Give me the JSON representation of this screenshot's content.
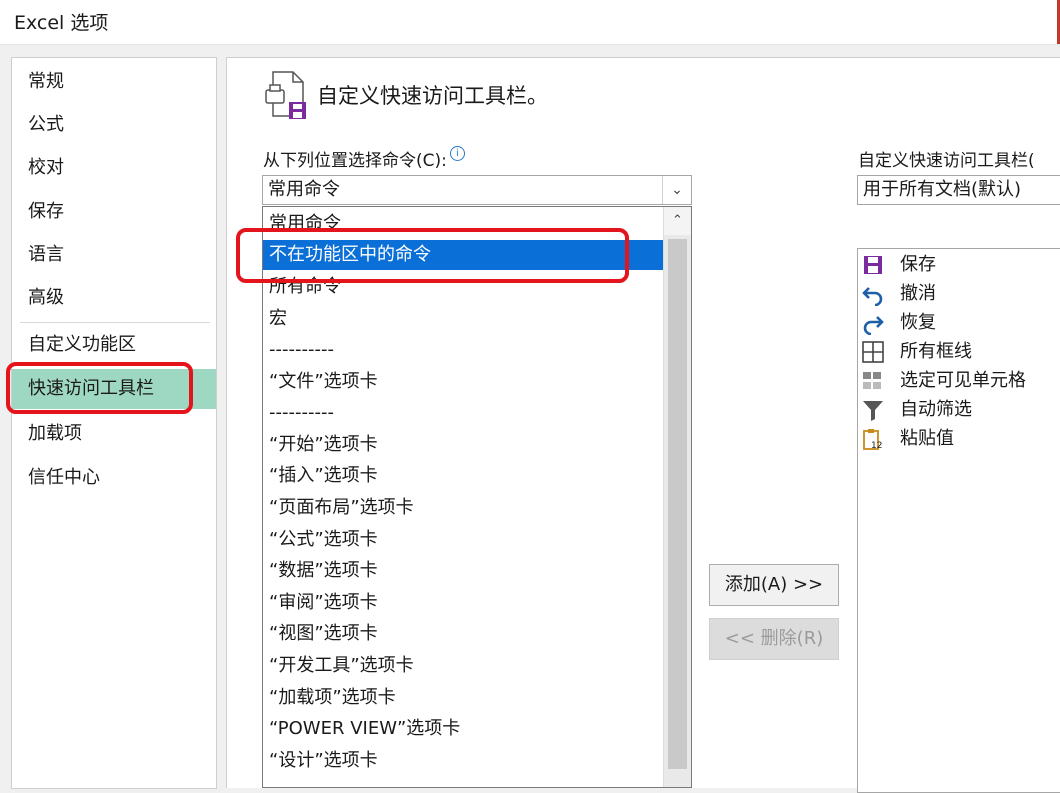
{
  "window": {
    "title": "Excel 选项"
  },
  "sidebar": {
    "items": [
      {
        "label": "常规"
      },
      {
        "label": "公式"
      },
      {
        "label": "校对"
      },
      {
        "label": "保存"
      },
      {
        "label": "语言"
      },
      {
        "label": "高级"
      },
      {
        "label": "自定义功能区"
      },
      {
        "label": "快速访问工具栏"
      },
      {
        "label": "加载项"
      },
      {
        "label": "信任中心"
      }
    ],
    "selected": "快速访问工具栏"
  },
  "main": {
    "heading": "自定义快速访问工具栏。",
    "choose_label": "从下列位置选择命令(C):",
    "choose_value": "常用命令",
    "commands": [
      "常用命令",
      "不在功能区中的命令",
      "所有命令",
      "宏",
      "----------",
      "“文件”选项卡",
      "----------",
      "“开始”选项卡",
      "“插入”选项卡",
      "“页面布局”选项卡",
      "“公式”选项卡",
      "“数据”选项卡",
      "“审阅”选项卡",
      "“视图”选项卡",
      "“开发工具”选项卡",
      "“加载项”选项卡",
      "“POWER VIEW”选项卡",
      "“设计”选项卡"
    ],
    "highlighted_command": "不在功能区中的命令",
    "add_button": "添加(A) >>",
    "remove_button": "<< 删除(R)",
    "toolbar_label": "自定义快速访问工具栏(",
    "toolbar_value": "用于所有文档(默认)",
    "toolbar_items": [
      {
        "label": "保存",
        "icon": "save-icon"
      },
      {
        "label": "撤消",
        "icon": "undo-icon"
      },
      {
        "label": "恢复",
        "icon": "redo-icon"
      },
      {
        "label": "所有框线",
        "icon": "all-borders-icon"
      },
      {
        "label": "选定可见单元格",
        "icon": "select-visible-cells-icon"
      },
      {
        "label": "自动筛选",
        "icon": "filter-icon"
      },
      {
        "label": "粘贴值",
        "icon": "paste-values-icon"
      }
    ]
  },
  "colors": {
    "highlight": "#0a6fd6",
    "nav_selected": "#9ed8c2",
    "annotation_red": "#e3141b"
  }
}
